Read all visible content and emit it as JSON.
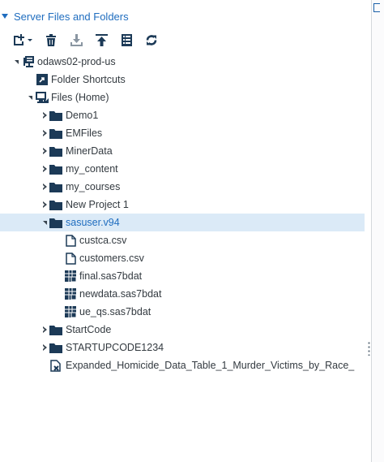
{
  "header": {
    "title": "Server Files and Folders"
  },
  "toolbar": {
    "items": [
      {
        "name": "new-dropdown-button",
        "icon": "new-file-icon"
      },
      {
        "name": "delete-button",
        "icon": "trash-icon"
      },
      {
        "name": "download-button",
        "icon": "download-icon"
      },
      {
        "name": "upload-button",
        "icon": "upload-icon"
      },
      {
        "name": "properties-button",
        "icon": "properties-icon"
      },
      {
        "name": "refresh-button",
        "icon": "refresh-icon"
      }
    ]
  },
  "tree": {
    "server": "odaws02-prod-us",
    "folder_shortcuts": "Folder Shortcuts",
    "files_home": "Files (Home)",
    "folders": {
      "demo1": "Demo1",
      "emfiles": "EMFiles",
      "minerdata": "MinerData",
      "my_content": "my_content",
      "my_courses": "my_courses",
      "new_project": "New Project 1",
      "sasuser": "sasuser.v94",
      "startcode": "StartCode",
      "startupcode": "STARTUPCODE1234"
    },
    "files": {
      "custca": "custca.csv",
      "customers": "customers.csv",
      "final": "final.sas7bdat",
      "newdata": "newdata.sas7bdat",
      "ue_qs": "ue_qs.sas7bdat",
      "expanded": "Expanded_Homicide_Data_Table_1_Murder_Victims_by_Race_"
    }
  },
  "colors": {
    "accent": "#1f6dbf",
    "folder": "#1c3a57",
    "selected_bg": "#dbeaf7"
  }
}
